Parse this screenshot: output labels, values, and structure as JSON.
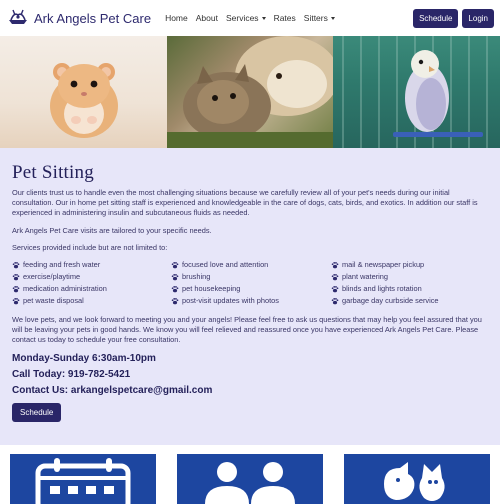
{
  "brand": {
    "name": "Ark Angels Pet Care"
  },
  "nav": {
    "items": [
      {
        "label": "Home"
      },
      {
        "label": "About"
      },
      {
        "label": "Services"
      },
      {
        "label": "Rates"
      },
      {
        "label": "Sitters"
      }
    ],
    "schedule_label": "Schedule",
    "login_label": "Login"
  },
  "main": {
    "title": "Pet Sitting",
    "para1": "Our clients trust us to handle even the most challenging situations because we carefully review all of your pet's needs during our initial consultation. Our in home pet sitting staff is experienced and knowledgeable in the care of dogs, cats, birds, and exotics. In addition our staff is experienced in administering insulin and subcutaneous fluids as needed.",
    "para2": "Ark Angels Pet Care visits are tailored to your specific needs.",
    "para3": "Services provided include but are not limited to:",
    "services": [
      "feeding and fresh water",
      "focused love and attention",
      "mail & newspaper pickup",
      "exercise/playtime",
      "brushing",
      "plant watering",
      "medication administration",
      "pet housekeeping",
      "blinds and lights rotation",
      "pet waste disposal",
      "post-visit updates with photos",
      "garbage day curbside service"
    ],
    "para4": "We love pets, and we look forward to meeting you and your angels! Please feel free to ask us questions that may help you feel assured that you will be leaving your pets in good hands. We know you will feel relieved and reassured once you have experienced Ark Angels Pet Care. Please contact us today to schedule your free consultation.",
    "hours": "Monday-Sunday 6:30am-10pm",
    "phone": "Call Today: 919-782-5421",
    "email": "Contact Us: arkangelspetcare@gmail.com",
    "schedule_label": "Schedule"
  },
  "colors": {
    "nav_button": "#2a2668",
    "main_bg": "#e7e6f9",
    "card_bg": "#1d46a0"
  },
  "icons": [
    "ark-logo-icon",
    "paw-icon",
    "calendar-icon",
    "people-icon",
    "pets-icon"
  ]
}
